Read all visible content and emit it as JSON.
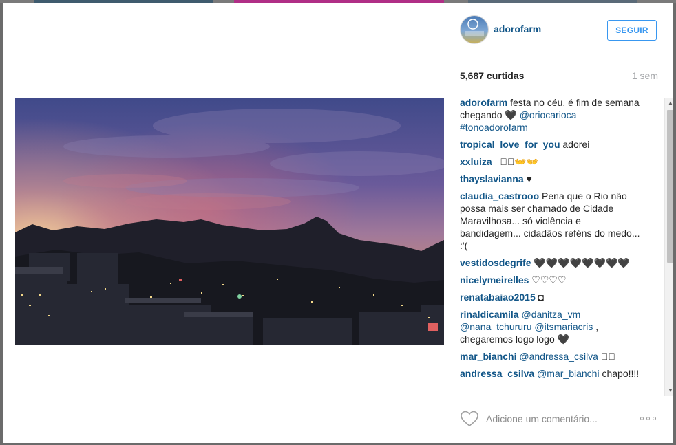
{
  "post": {
    "username": "adorofarm",
    "follow_label": "SEGUIR",
    "likes": "5,687 curtidas",
    "time": "1 sem"
  },
  "comments": [
    {
      "user": "adorofarm",
      "parts": [
        {
          "t": "text",
          "v": " festa no céu, é fim de semana chegando 🖤 "
        },
        {
          "t": "mention",
          "v": "@oriocarioca"
        },
        {
          "t": "text",
          "v": " "
        },
        {
          "t": "mention",
          "v": "#tonoadorofarm"
        }
      ]
    },
    {
      "user": "tropical_love_for_you",
      "parts": [
        {
          "t": "text",
          "v": " adorei"
        }
      ]
    },
    {
      "user": "xxluiza_",
      "parts": [
        {
          "t": "text",
          "v": " ⃞⃞👐👐"
        }
      ]
    },
    {
      "user": "thayslavianna",
      "parts": [
        {
          "t": "text",
          "v": " ♥"
        }
      ]
    },
    {
      "user": "claudia_castrooo",
      "parts": [
        {
          "t": "text",
          "v": " Pena que o Rio não possa mais ser chamado de Cidade Maravilhosa... só violência e bandidagem... cidadãos reféns do medo... :'("
        }
      ]
    },
    {
      "user": "vestidosdegrife",
      "parts": [
        {
          "t": "text",
          "v": " 🖤🖤🖤🖤🖤🖤🖤🖤"
        }
      ]
    },
    {
      "user": "nicelymeirelles",
      "parts": [
        {
          "t": "text",
          "v": " ♡♡♡♡"
        }
      ]
    },
    {
      "user": "renatabaiao2015",
      "parts": [
        {
          "t": "text",
          "v": " ◘"
        }
      ]
    },
    {
      "user": "rinaldicamila",
      "parts": [
        {
          "t": "text",
          "v": " "
        },
        {
          "t": "mention",
          "v": "@danitza_vm"
        },
        {
          "t": "text",
          "v": " "
        },
        {
          "t": "mention",
          "v": "@nana_tchururu"
        },
        {
          "t": "text",
          "v": " "
        },
        {
          "t": "mention",
          "v": "@itsmariacris"
        },
        {
          "t": "text",
          "v": " , chegaremos logo logo 🖤"
        }
      ]
    },
    {
      "user": "mar_bianchi",
      "parts": [
        {
          "t": "text",
          "v": " "
        },
        {
          "t": "mention",
          "v": "@andressa_csilva"
        },
        {
          "t": "text",
          "v": " ⃞⃞"
        }
      ]
    },
    {
      "user": "andressa_csilva",
      "parts": [
        {
          "t": "text",
          "v": " "
        },
        {
          "t": "mention",
          "v": "@mar_bianchi"
        },
        {
          "t": "text",
          "v": " chapo!!!! ⃞⃞⃞"
        }
      ]
    }
  ],
  "footer": {
    "comment_placeholder": "Adicione um comentário..."
  },
  "colors": {
    "link": "#125688",
    "follow": "#3897f0",
    "muted": "#a5a7aa"
  },
  "icons": {
    "like": "heart-outline-icon",
    "more": "more-options-icon",
    "scroll_up": "scroll-up-arrow-icon",
    "scroll_down": "scroll-down-arrow-icon"
  }
}
